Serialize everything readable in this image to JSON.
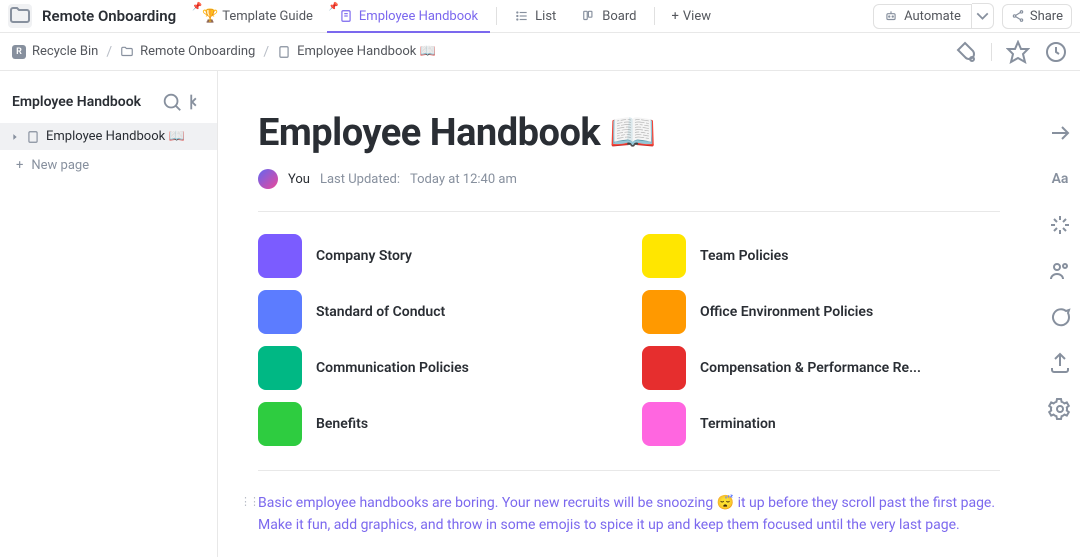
{
  "workspace_name": "Remote Onboarding",
  "tabs": [
    {
      "icon": "trophy",
      "label": "Template Guide"
    },
    {
      "icon": "doc",
      "label": "Employee Handbook"
    },
    {
      "icon": "list",
      "label": "List"
    },
    {
      "icon": "board",
      "label": "Board"
    }
  ],
  "view_tab_label": "View",
  "automate_label": "Automate",
  "share_label": "Share",
  "breadcrumb": {
    "badge": "R",
    "items": [
      {
        "label": "Recycle Bin"
      },
      {
        "label": "Remote Onboarding"
      },
      {
        "label": "Employee Handbook 📖"
      }
    ]
  },
  "sidebar": {
    "title": "Employee Handbook",
    "tree_item": "Employee Handbook 📖",
    "new_page": "New page"
  },
  "doc": {
    "title": "Employee Handbook 📖",
    "author": "You",
    "updated_label": "Last Updated:",
    "updated_value": "Today at 12:40 am"
  },
  "cards": [
    {
      "label": "Company Story",
      "color": "#7b5cff"
    },
    {
      "label": "Team Policies",
      "color": "#ffe600"
    },
    {
      "label": "Standard of Conduct",
      "color": "#5c7cff"
    },
    {
      "label": "Office Environment Policies",
      "color": "#ff9900"
    },
    {
      "label": "Communication Policies",
      "color": "#00b884"
    },
    {
      "label": "Compensation & Performance Re...",
      "color": "#e62e2e"
    },
    {
      "label": "Benefits",
      "color": "#2ecc40"
    },
    {
      "label": "Termination",
      "color": "#ff66e0"
    }
  ],
  "paragraph": "Basic employee handbooks are boring. Your new recruits will be snoozing 😴  it up before they scroll past the first page. Make it fun, add graphics, and throw in some emojis to spice it up and keep them focused until the very last page."
}
